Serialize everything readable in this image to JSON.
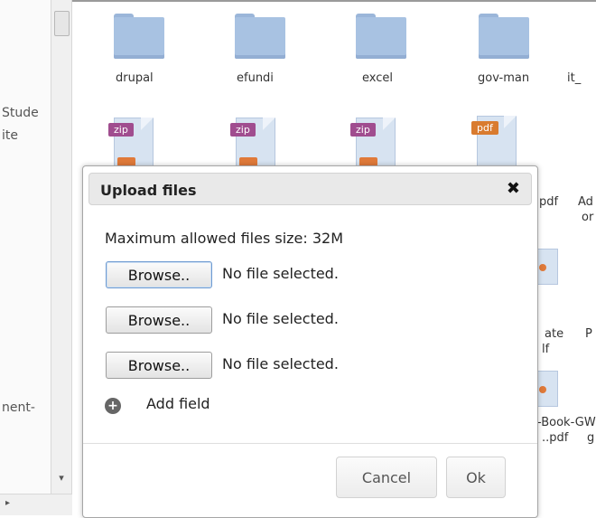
{
  "left_pane": {
    "items": [
      "Stude",
      "ite",
      "nent-"
    ]
  },
  "folders": [
    {
      "name": "drupal"
    },
    {
      "name": "efundi"
    },
    {
      "name": "excel"
    },
    {
      "name": "gov-man"
    },
    {
      "name": "it_"
    }
  ],
  "files": [
    {
      "type": "zip"
    },
    {
      "type": "zip"
    },
    {
      "type": "zip"
    },
    {
      "type": "pdf"
    }
  ],
  "partial_labels": [
    {
      "text": "pdf"
    },
    {
      "text": "Ad"
    },
    {
      "text": "or"
    },
    {
      "text": "ate"
    },
    {
      "text": "P"
    },
    {
      "text": "lf"
    },
    {
      "text": "-Book-GW"
    },
    {
      "text": "..pdf"
    },
    {
      "text": "g"
    }
  ],
  "dialog": {
    "title": "Upload files",
    "max_size": "Maximum allowed files size: 32M",
    "browse_label": "Browse..",
    "file_status": "No file selected.",
    "add_field": "Add field",
    "cancel": "Cancel",
    "ok": "Ok"
  },
  "icons": {
    "close": "close-icon",
    "add": "plus-circle-icon"
  }
}
